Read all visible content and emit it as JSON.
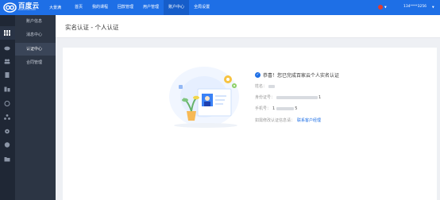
{
  "app": {
    "logo_title": "百度云",
    "logo_sub": "BAIDUYUN.COM",
    "brand_sub": "大景满"
  },
  "nav": {
    "items": [
      {
        "label": "首页",
        "active": false
      },
      {
        "label": "我的课程",
        "active": false
      },
      {
        "label": "回款管理",
        "active": false
      },
      {
        "label": "用户管理",
        "active": false
      },
      {
        "label": "账户中心",
        "active": true
      },
      {
        "label": "全局设置",
        "active": false
      }
    ]
  },
  "user": {
    "account": "134****3256",
    "flag_color": "#e23b2e"
  },
  "rail": {
    "icons": [
      "grid-icon",
      "cloud-icon",
      "users-icon",
      "document-icon",
      "layers-icon",
      "clock-icon",
      "network-icon",
      "settings-icon",
      "coin-icon",
      "folder-icon"
    ]
  },
  "subnav": {
    "items": [
      {
        "label": "账户信息",
        "active": false
      },
      {
        "label": "消息中心",
        "active": false
      },
      {
        "label": "认证中心",
        "active": true
      },
      {
        "label": "合同管理",
        "active": false
      }
    ]
  },
  "page": {
    "title": "实名认证 - 个人认证"
  },
  "result": {
    "success_text": "恭喜！您已完成百家云个人实名认证",
    "name_label": "姓名：",
    "id_label": "身份证号：",
    "id_tail": "1",
    "phone_label": "手机号：",
    "phone_head": "1",
    "phone_tail": "5",
    "help_label": "如需修改认证信息请：",
    "help_link": "联系客户经理"
  },
  "colors": {
    "brand": "#1e6fe6",
    "topbar": "#1e6fe6",
    "rail": "#1f2735",
    "subnav": "#2c3544"
  }
}
